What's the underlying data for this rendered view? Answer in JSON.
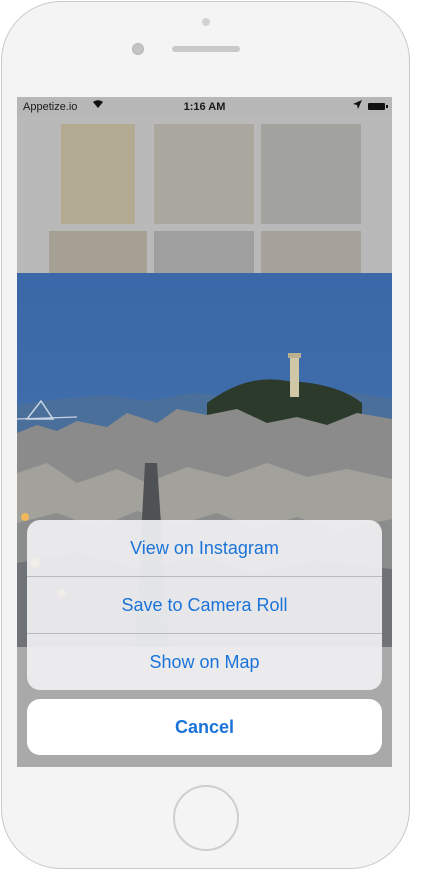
{
  "status_bar": {
    "carrier": "Appetize.io",
    "time": "1:16 AM"
  },
  "action_sheet": {
    "items": [
      {
        "label": "View on Instagram"
      },
      {
        "label": "Save to Camera Roll"
      },
      {
        "label": "Show on Map"
      }
    ],
    "cancel_label": "Cancel"
  },
  "colors": {
    "accent": "#1a73d9",
    "sheet_background": "#f0f0f2",
    "status_bar": "#b7b7b7"
  },
  "icons": [
    "wifi-icon",
    "location-arrow-icon",
    "battery-icon"
  ]
}
